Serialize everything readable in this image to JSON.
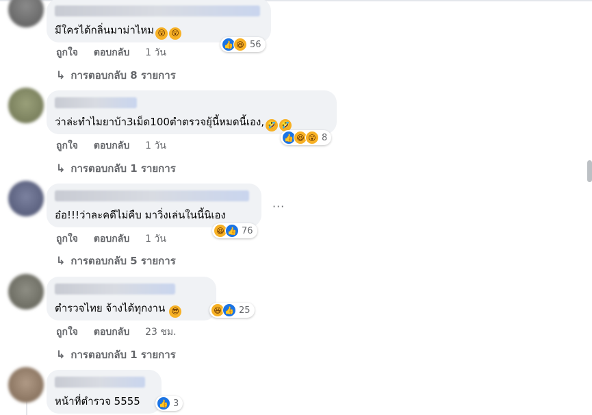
{
  "comments": [
    {
      "text": "มีใครได้กลิ่นมาม่าไหม",
      "inline_emojis": [
        "astonished-emoji",
        "astonished-emoji"
      ],
      "reactions": [
        "like",
        "haha"
      ],
      "reaction_count": "56",
      "like_label": "ถูกใจ",
      "reply_label": "ตอบกลับ",
      "time": "1 วัน",
      "replies_label": "การตอบกลับ 8 รายการ"
    },
    {
      "text": "ว่าล่ะทำไมยาบ้า3เม็ด100ตำตรวจยุ้นี้หมดนี้เอง,",
      "inline_emojis": [
        "rofl-emoji",
        "rofl-emoji"
      ],
      "reactions": [
        "like",
        "haha",
        "wow"
      ],
      "reaction_count": "8",
      "like_label": "ถูกใจ",
      "reply_label": "ตอบกลับ",
      "time": "1 วัน",
      "replies_label": "การตอบกลับ 1 รายการ"
    },
    {
      "text": "อ๋อ!!!ว่าละคดีไม่คืบ มาวิ่งเล่นในนี้นิเอง",
      "inline_emojis": [],
      "reactions": [
        "haha",
        "like"
      ],
      "reaction_count": "76",
      "like_label": "ถูกใจ",
      "reply_label": "ตอบกลับ",
      "time": "1 วัน",
      "replies_label": "การตอบกลับ 5 รายการ"
    },
    {
      "text": "ตำรวจไทย จ้างได้ทุกงาน",
      "inline_emojis": [
        "sunglasses-emoji"
      ],
      "reactions": [
        "haha",
        "like"
      ],
      "reaction_count": "25",
      "like_label": "ถูกใจ",
      "reply_label": "ตอบกลับ",
      "time": "23 ชม.",
      "replies_label": "การตอบกลับ 1 รายการ"
    },
    {
      "text": "หน้าที่ตำรวจ 5555",
      "inline_emojis": [],
      "reactions": [
        "like"
      ],
      "reaction_count": "3"
    }
  ],
  "more_options": "···",
  "colors": {
    "bubble": "#f0f2f5",
    "secondary_text": "#65676b",
    "like_blue": "#1b74e4",
    "haha_yellow": "#f7b125"
  }
}
